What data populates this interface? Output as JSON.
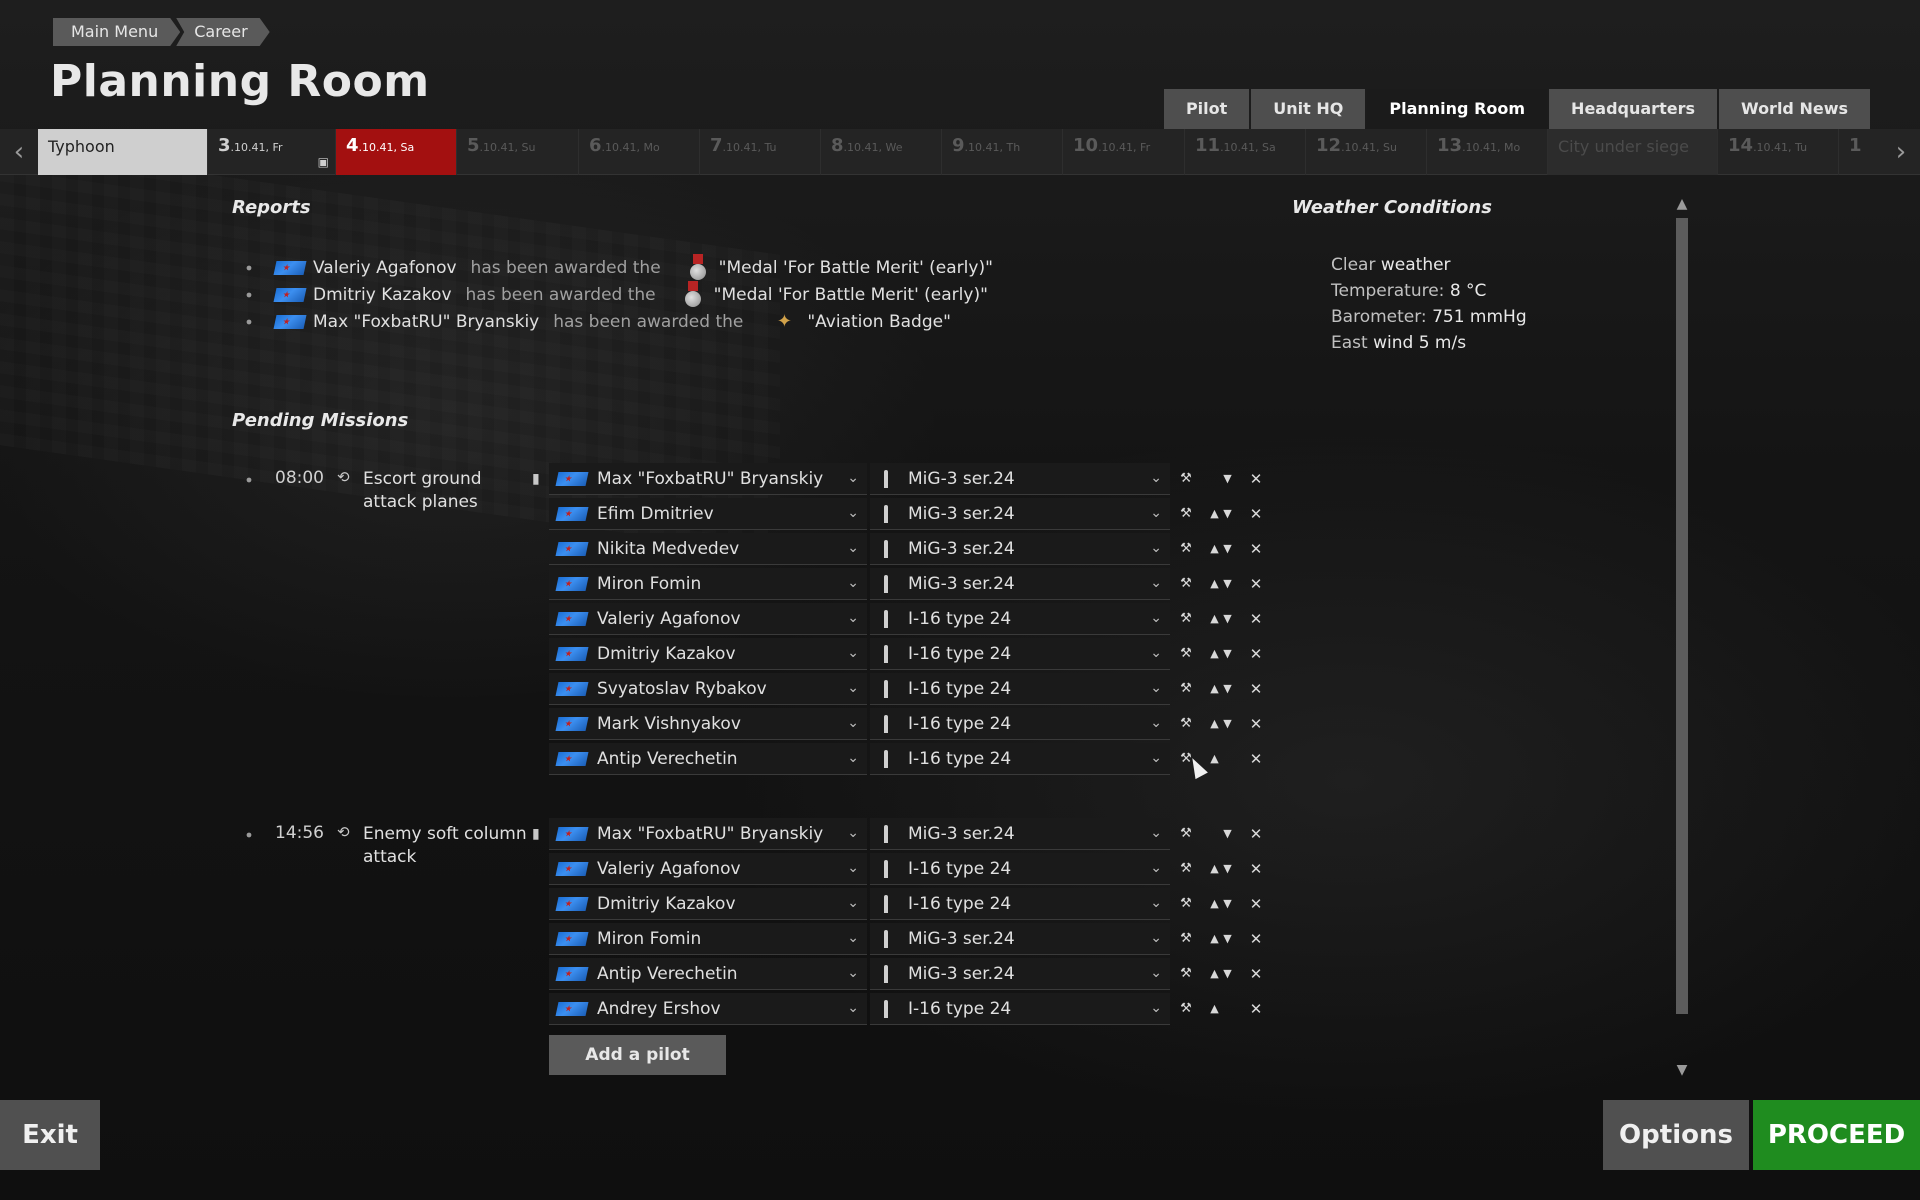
{
  "breadcrumb": [
    "Main Menu",
    "Career"
  ],
  "page_title": "Planning Room",
  "nav_tabs": [
    {
      "label": "Pilot",
      "active": false
    },
    {
      "label": "Unit HQ",
      "active": false
    },
    {
      "label": "Planning Room",
      "active": true
    },
    {
      "label": "Headquarters",
      "active": false
    },
    {
      "label": "World News",
      "active": false
    }
  ],
  "timeline": [
    {
      "kind": "event",
      "label": "Typhoon"
    },
    {
      "kind": "past",
      "num": "3",
      "date": ".10.41, Fr",
      "brief_icon": "briefcase-icon"
    },
    {
      "kind": "current",
      "num": "4",
      "date": ".10.41, Sa"
    },
    {
      "kind": "future",
      "num": "5",
      "date": ".10.41, Su"
    },
    {
      "kind": "future",
      "num": "6",
      "date": ".10.41, Mo"
    },
    {
      "kind": "future",
      "num": "7",
      "date": ".10.41, Tu"
    },
    {
      "kind": "future",
      "num": "8",
      "date": ".10.41, We"
    },
    {
      "kind": "future",
      "num": "9",
      "date": ".10.41, Th"
    },
    {
      "kind": "future",
      "num": "10",
      "date": ".10.41, Fr"
    },
    {
      "kind": "future",
      "num": "11",
      "date": ".10.41, Sa"
    },
    {
      "kind": "future",
      "num": "12",
      "date": ".10.41, Su"
    },
    {
      "kind": "future",
      "num": "13",
      "date": ".10.41, Mo"
    },
    {
      "kind": "event2",
      "label": "City under siege"
    },
    {
      "kind": "future",
      "num": "14",
      "date": ".10.41, Tu"
    },
    {
      "kind": "future",
      "num": "1",
      "date": ""
    }
  ],
  "reports": {
    "title": "Reports",
    "items": [
      {
        "name": "Valeriy Agafonov",
        "text": "has been awarded the",
        "award": "\"Medal 'For Battle Merit' (early)\"",
        "award_icon": "medal-icon"
      },
      {
        "name": "Dmitriy Kazakov",
        "text": "has been awarded the",
        "award": "\"Medal 'For Battle Merit' (early)\"",
        "award_icon": "medal-icon"
      },
      {
        "name": "Max \"FoxbatRU\" Bryanskiy",
        "text": "has been awarded the",
        "award": "\"Aviation Badge\"",
        "award_icon": "aviation-badge-icon"
      }
    ]
  },
  "weather": {
    "title": "Weather Conditions",
    "lines": [
      {
        "label": "Clear",
        "value": " weather"
      },
      {
        "label": "Temperature: ",
        "value": "8 °C"
      },
      {
        "label": "Barometer: ",
        "value": "751 mmHg"
      },
      {
        "label": "East",
        "value": " wind 5 m/s"
      }
    ]
  },
  "pending": {
    "title": "Pending Missions",
    "add_pilot_label": "Add a pilot",
    "missions": [
      {
        "time": "08:00",
        "name": "Escort ground attack planes",
        "slots": [
          {
            "pilot": "Max \"FoxbatRU\" Bryanskiy",
            "plane": "MiG-3 ser.24"
          },
          {
            "pilot": "Efim Dmitriev",
            "plane": "MiG-3 ser.24"
          },
          {
            "pilot": "Nikita Medvedev",
            "plane": "MiG-3 ser.24"
          },
          {
            "pilot": "Miron Fomin",
            "plane": "MiG-3 ser.24"
          },
          {
            "pilot": "Valeriy Agafonov",
            "plane": "I-16 type 24"
          },
          {
            "pilot": "Dmitriy Kazakov",
            "plane": "I-16 type 24"
          },
          {
            "pilot": "Svyatoslav Rybakov",
            "plane": "I-16 type 24"
          },
          {
            "pilot": "Mark Vishnyakov",
            "plane": "I-16 type 24"
          },
          {
            "pilot": "Antip Verechetin",
            "plane": "I-16 type 24"
          }
        ]
      },
      {
        "time": "14:56",
        "name": "Enemy soft column attack",
        "slots": [
          {
            "pilot": "Max \"FoxbatRU\" Bryanskiy",
            "plane": "MiG-3 ser.24"
          },
          {
            "pilot": "Valeriy Agafonov",
            "plane": "I-16 type 24"
          },
          {
            "pilot": "Dmitriy Kazakov",
            "plane": "I-16 type 24"
          },
          {
            "pilot": "Miron Fomin",
            "plane": "MiG-3 ser.24"
          },
          {
            "pilot": "Antip Verechetin",
            "plane": "MiG-3 ser.24"
          },
          {
            "pilot": "Andrey Ershov",
            "plane": "I-16 type 24"
          }
        ]
      }
    ]
  },
  "footer": {
    "exit_label": "Exit",
    "options_label": "Options",
    "proceed_label": "PROCEED"
  },
  "colors": {
    "accent_red": "#a31010",
    "proceed_green": "#1f8c1f"
  }
}
